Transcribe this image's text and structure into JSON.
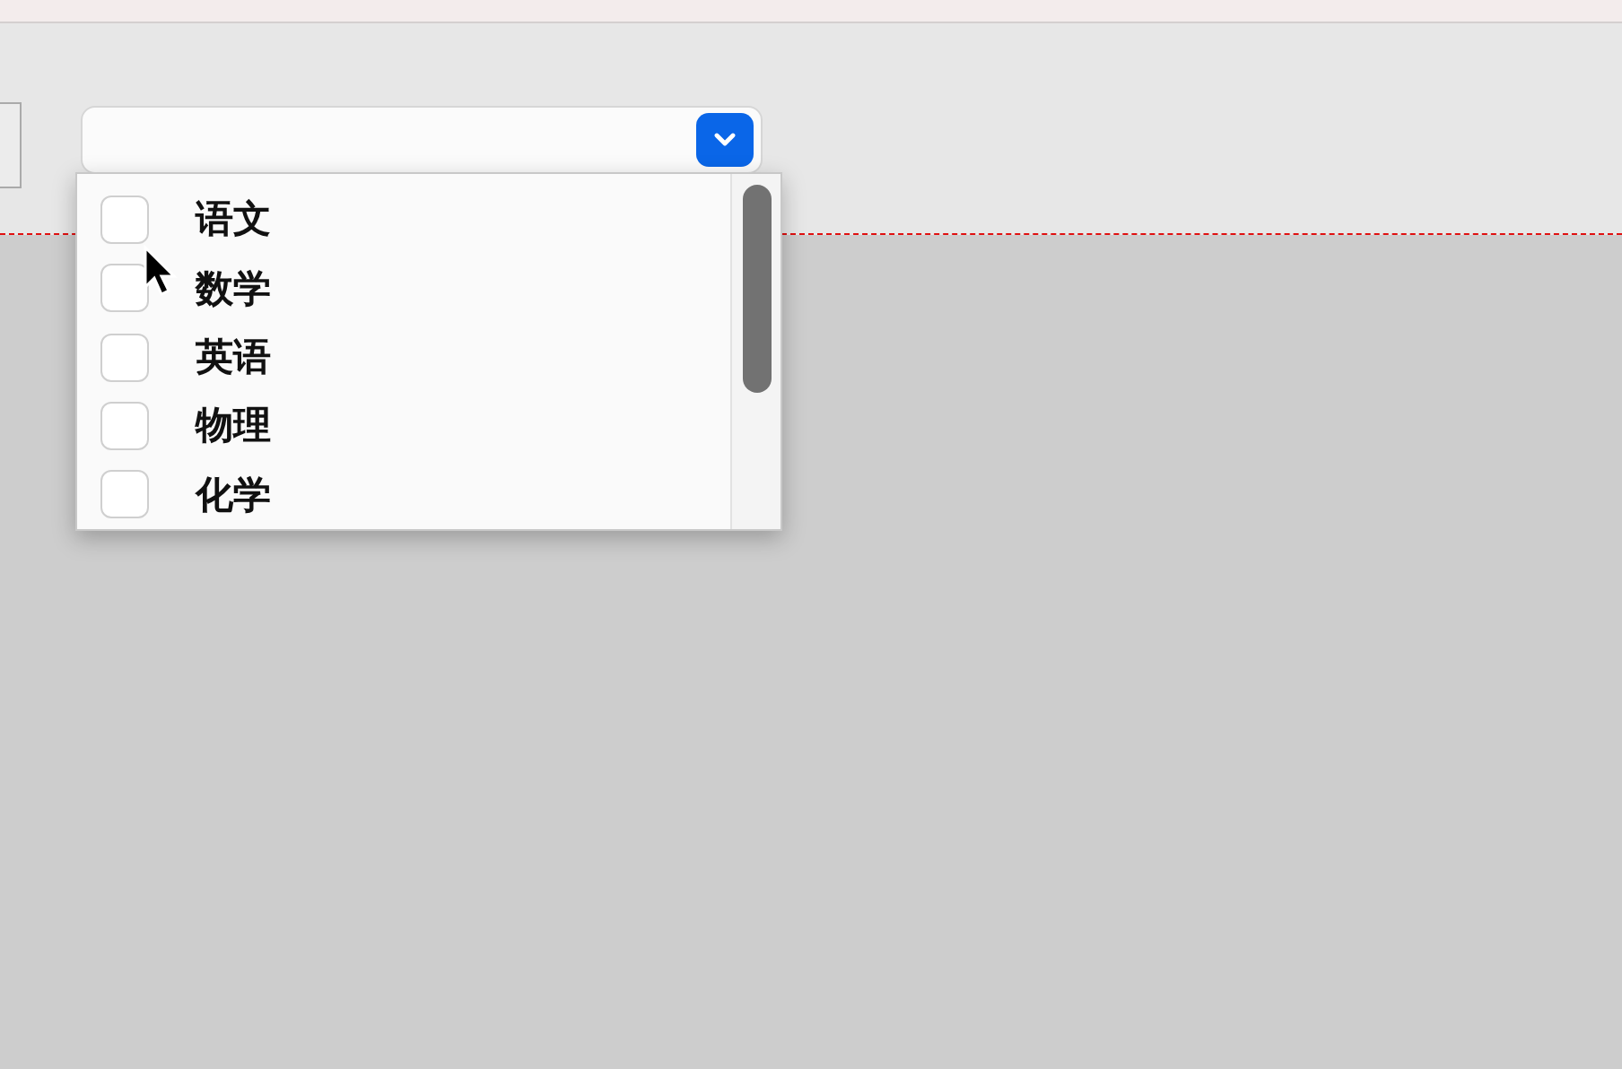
{
  "dropdown": {
    "expanded": true,
    "options": [
      {
        "label": "语文",
        "checked": false
      },
      {
        "label": "数学",
        "checked": false
      },
      {
        "label": "英语",
        "checked": false
      },
      {
        "label": "物理",
        "checked": false
      },
      {
        "label": "化学",
        "checked": false
      }
    ]
  }
}
